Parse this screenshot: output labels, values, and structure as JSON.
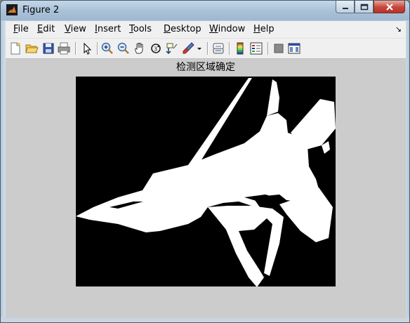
{
  "window": {
    "title": "Figure 2",
    "controls": [
      "minimize",
      "maximize",
      "close"
    ]
  },
  "menu": {
    "items": [
      {
        "label": "File",
        "mnemonic": "F",
        "rest": "ile"
      },
      {
        "label": "Edit",
        "mnemonic": "E",
        "rest": "dit"
      },
      {
        "label": "View",
        "mnemonic": "V",
        "rest": "iew"
      },
      {
        "label": "Insert",
        "mnemonic": "I",
        "rest": "nsert"
      },
      {
        "label": "Tools",
        "mnemonic": "T",
        "rest": "ools"
      },
      {
        "label": "Desktop",
        "mnemonic": "D",
        "rest": "esktop"
      },
      {
        "label": "Window",
        "mnemonic": "W",
        "rest": "indow"
      },
      {
        "label": "Help",
        "mnemonic": "H",
        "rest": "elp"
      }
    ],
    "overflow_glyph": "↘"
  },
  "toolbar": {
    "icons": [
      "new-figure-icon",
      "open-file-icon",
      "save-icon",
      "print-icon",
      "edit-plot-arrow-icon",
      "zoom-in-icon",
      "zoom-out-icon",
      "pan-hand-icon",
      "rotate-3d-icon",
      "data-cursor-icon",
      "brush-icon",
      "brush-dropdown-icon",
      "link-plot-icon",
      "colorbar-icon",
      "legend-icon",
      "hide-plot-tools-icon",
      "show-plot-tools-icon"
    ]
  },
  "figure": {
    "axes_title": "检测区域确定",
    "image": "binary silhouette of a fighter jet (white on black)"
  },
  "colors": {
    "figure_background": "#cccccc",
    "axes_background": "#000000",
    "silhouette": "#ffffff"
  }
}
